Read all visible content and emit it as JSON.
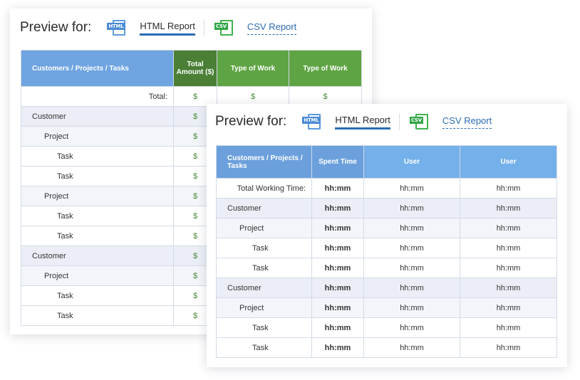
{
  "back_card": {
    "preview_label": "Preview for:",
    "html_icon": "HTML",
    "html_tab": "HTML Report",
    "csv_icon": "CSV",
    "csv_tab": "CSV Report",
    "columns": [
      "Customers / Projects / Tasks",
      "Total Amount ($)",
      "Type of Work",
      "Type of Work"
    ],
    "rows": [
      {
        "level": "total",
        "name": "Total:",
        "values": [
          "$",
          "$",
          "$"
        ]
      },
      {
        "level": "customer",
        "name": "Customer",
        "values": [
          "$",
          "",
          ""
        ]
      },
      {
        "level": "project",
        "name": "Project",
        "values": [
          "$",
          "",
          ""
        ]
      },
      {
        "level": "task",
        "name": "Task",
        "values": [
          "$",
          "",
          ""
        ]
      },
      {
        "level": "task",
        "name": "Task",
        "values": [
          "$",
          "",
          ""
        ]
      },
      {
        "level": "project",
        "name": "Project",
        "values": [
          "$",
          "",
          ""
        ]
      },
      {
        "level": "task",
        "name": "Task",
        "values": [
          "$",
          "",
          ""
        ]
      },
      {
        "level": "task",
        "name": "Task",
        "values": [
          "$",
          "",
          ""
        ]
      },
      {
        "level": "customer",
        "name": "Customer",
        "values": [
          "$",
          "",
          ""
        ]
      },
      {
        "level": "project",
        "name": "Project",
        "values": [
          "$",
          "",
          ""
        ]
      },
      {
        "level": "task",
        "name": "Task",
        "values": [
          "$",
          "",
          ""
        ]
      },
      {
        "level": "task",
        "name": "Task",
        "values": [
          "$",
          "",
          ""
        ]
      }
    ]
  },
  "front_card": {
    "preview_label": "Preview for:",
    "html_icon": "HTML",
    "html_tab": "HTML Report",
    "csv_icon": "CSV",
    "csv_tab": "CSV Report",
    "columns": [
      "Customers / Projects / Tasks",
      "Spent Time",
      "User",
      "User"
    ],
    "rows": [
      {
        "level": "total",
        "name": "Total Working Time:",
        "values": [
          "hh:mm",
          "hh:mm",
          "hh:mm"
        ]
      },
      {
        "level": "customer",
        "name": "Customer",
        "values": [
          "hh:mm",
          "hh:mm",
          "hh:mm"
        ]
      },
      {
        "level": "project",
        "name": "Project",
        "values": [
          "hh:mm",
          "hh:mm",
          "hh:mm"
        ]
      },
      {
        "level": "task",
        "name": "Task",
        "values": [
          "hh:mm",
          "hh:mm",
          "hh:mm"
        ]
      },
      {
        "level": "task",
        "name": "Task",
        "values": [
          "hh:mm",
          "hh:mm",
          "hh:mm"
        ]
      },
      {
        "level": "customer",
        "name": "Customer",
        "values": [
          "hh:mm",
          "hh:mm",
          "hh:mm"
        ]
      },
      {
        "level": "project",
        "name": "Project",
        "values": [
          "hh:mm",
          "hh:mm",
          "hh:mm"
        ]
      },
      {
        "level": "task",
        "name": "Task",
        "values": [
          "hh:mm",
          "hh:mm",
          "hh:mm"
        ]
      },
      {
        "level": "task",
        "name": "Task",
        "values": [
          "hh:mm",
          "hh:mm",
          "hh:mm"
        ]
      }
    ]
  },
  "colors": {
    "accent_blue": "#2b6cb5",
    "header_blue": "#6fa4e0",
    "header_dark_green": "#4a7f35",
    "header_green": "#5fa444",
    "money_green": "#4a8a3a"
  }
}
